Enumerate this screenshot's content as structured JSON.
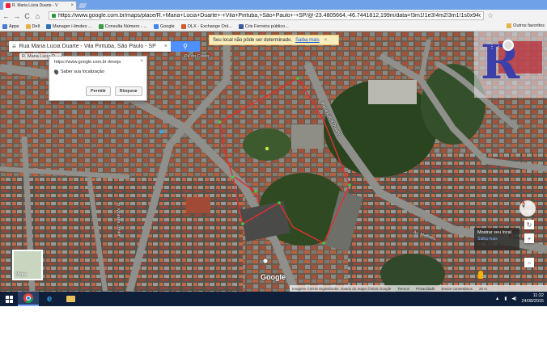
{
  "browser": {
    "tab_title": "R. Maria Lúcia Duarte - V",
    "tab_close": "×",
    "url": "https://www.google.com.br/maps/place/R.+Maria+Lúcia+Duarte+-+Vila+Pirituba,+São+Paulo+-+SP/@-23.4805664,-46.7441812,199m/data=!3m1!1e3!4m2!3m1!1s0x94cef85",
    "nav": {
      "back": "←",
      "forward": "→",
      "reload": "C",
      "home": "⌂"
    },
    "star": "☆"
  },
  "bookmarks": [
    {
      "label": "Apps",
      "icon": "apps-icon",
      "color": "#4a7bd0"
    },
    {
      "label": "Dell",
      "icon": "folder-icon",
      "color": "#e4b44a"
    },
    {
      "label": "Manager i-limdeo ...",
      "icon": "page-icon",
      "color": "#2e74b5"
    },
    {
      "label": "Consulta Número - ...",
      "icon": "page-icon",
      "color": "#3d9b4a"
    },
    {
      "label": "Google",
      "icon": "google-icon",
      "color": "#4285f4"
    },
    {
      "label": "OLX - Exchange Onl...",
      "icon": "page-icon",
      "color": "#d35a2a"
    },
    {
      "label": "Cris Ferreira público...",
      "icon": "facebook-icon",
      "color": "#3b5998"
    }
  ],
  "other_bookmarks": "Outros favoritos",
  "maps": {
    "search_value": "Rua Maria Lúcia Duarte - Vila Pirituba, São Paulo - SP",
    "search_clear": "×",
    "address_chip": "R. Maria Lúcia D...",
    "notice_text": "Seu local não pôde ser determinado.",
    "notice_link": "Saiba mais",
    "notice_close": "×",
    "thumbnail_label": "Mapa",
    "google_logo": "Google",
    "my_location_title": "Mostrar seu local",
    "my_location_link": "Saiba mais",
    "attribution": [
      "Imagens ©2015 DigitalGlobe, Dados do mapa ©2015 Google",
      "Termos",
      "Privacidade",
      "Enviar comentários",
      "20 m"
    ],
    "zoom_in": "+",
    "zoom_out": "−",
    "apps_grid": "⋮⋮⋮"
  },
  "roads": [
    {
      "label": "Maria Lúcia Duarte",
      "rotate": 62
    },
    {
      "label": "Av. Mendes",
      "rotate": 0
    },
    {
      "label": "R. Moraes Júnior",
      "rotate": 90
    },
    {
      "label": "Pé do Cristo",
      "rotate": 0
    }
  ],
  "permission": {
    "site": "https://www.google.com.br deseja",
    "request": "Saber sua localização",
    "allow": "Permitir",
    "block": "Bloquear",
    "close": "×"
  },
  "taskbar": {
    "time": "11:22",
    "date": "24/08/2015"
  }
}
